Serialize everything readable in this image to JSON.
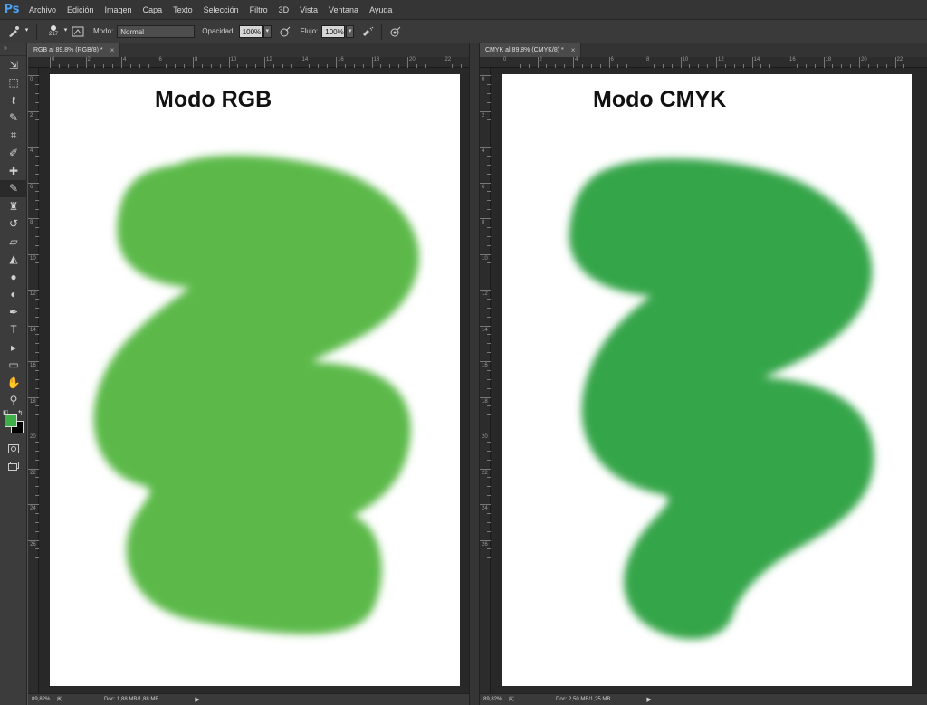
{
  "app": {
    "logo": "Ps"
  },
  "menu": [
    "Archivo",
    "Edición",
    "Imagen",
    "Capa",
    "Texto",
    "Selección",
    "Filtro",
    "3D",
    "Vista",
    "Ventana",
    "Ayuda"
  ],
  "options_bar": {
    "brush_size": "217",
    "mode_label": "Modo:",
    "mode_value": "Normal",
    "opacity_label": "Opacidad:",
    "opacity_value": "100%",
    "flow_label": "Flujo:",
    "flow_value": "100%"
  },
  "tools": [
    "move-tool",
    "marquee-tool",
    "lasso-tool",
    "quick-select-tool",
    "crop-tool",
    "eyedropper-tool",
    "spot-healing-tool",
    "brush-tool",
    "clone-stamp-tool",
    "history-brush-tool",
    "eraser-tool",
    "paint-bucket-tool",
    "blur-tool",
    "dodge-tool",
    "pen-tool",
    "type-tool",
    "path-select-tool",
    "shape-tool",
    "hand-tool",
    "zoom-tool"
  ],
  "colors": {
    "foreground": "#3fae49",
    "background": "#000000",
    "rgb_paint": "#5bb948",
    "cmyk_paint": "#34a548"
  },
  "documents": [
    {
      "tab": "RGB al 89,8% (RGB/8) *",
      "title": "Modo RGB",
      "zoom": "89,82%",
      "doc_info": "Doc: 1,88 MB/1,88 MB"
    },
    {
      "tab": "CMYK al 89,8% (CMYK/8) *",
      "title": "Modo CMYK",
      "zoom": "89,82%",
      "doc_info": "Doc: 2,50 MB/1,25 MB"
    }
  ],
  "ruler_h": [
    "0",
    "2",
    "4",
    "6",
    "8",
    "10",
    "12",
    "14",
    "16",
    "18",
    "20",
    "22"
  ],
  "ruler_v": [
    "0",
    "2",
    "4",
    "6",
    "8",
    "10",
    "12",
    "14",
    "16",
    "18",
    "20",
    "22",
    "24",
    "26"
  ]
}
